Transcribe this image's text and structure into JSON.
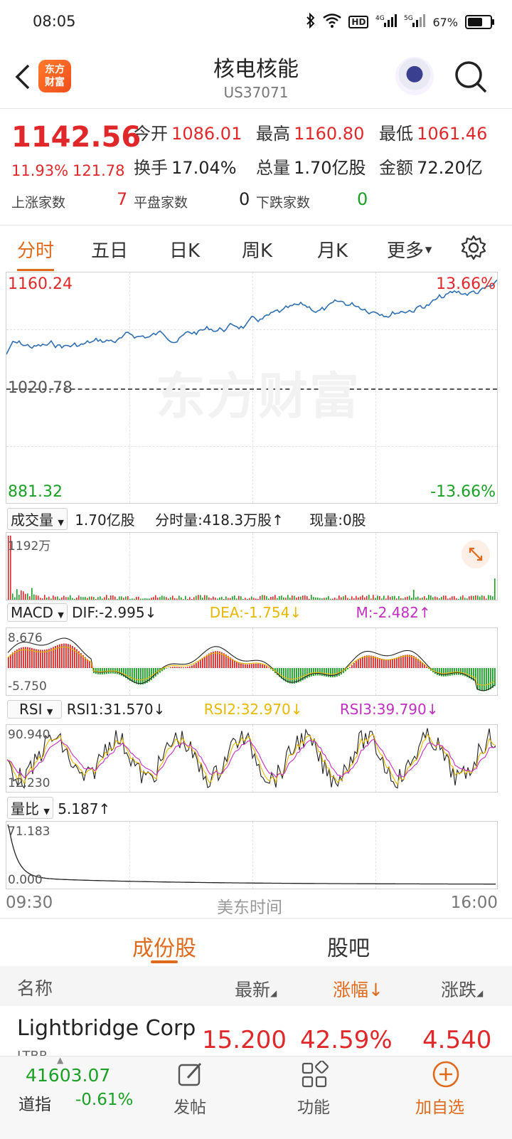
{
  "status": {
    "time": "08:05",
    "battery": "67%",
    "battery_level": 0.67
  },
  "header": {
    "title": "核电核能",
    "code": "US37071",
    "logo_text": "东方财富"
  },
  "quote": {
    "price": "1142.56",
    "change_pct": "11.93%",
    "change": "121.78",
    "stats": [
      {
        "label": "今开",
        "value": "1086.01",
        "color": "red"
      },
      {
        "label": "最高",
        "value": "1160.80",
        "color": "red"
      },
      {
        "label": "最低",
        "value": "1061.46",
        "color": "red"
      },
      {
        "label": "换手",
        "value": "17.04%",
        "color": "dark"
      },
      {
        "label": "总量",
        "value": "1.70亿股",
        "color": "dark"
      },
      {
        "label": "金额",
        "value": "72.20亿",
        "color": "dark"
      }
    ],
    "breadth": [
      {
        "label": "上涨家数",
        "value": "7",
        "color": "red"
      },
      {
        "label": "平盘家数",
        "value": "0",
        "color": "dark"
      },
      {
        "label": "下跌家数",
        "value": "0",
        "color": "green"
      }
    ]
  },
  "tabs": {
    "items": [
      "分时",
      "五日",
      "日K",
      "周K",
      "月K",
      "更多"
    ],
    "active": 0
  },
  "main_chart": {
    "upper": "1160.24",
    "mid": "1020.78",
    "lower": "881.32",
    "upper_pct": "13.66%",
    "lower_pct": "-13.66%",
    "watermark": "东方财富",
    "line_color": "#2f6fb0"
  },
  "volume": {
    "select": "成交量",
    "total": "1.70亿股",
    "minute": "分时量:418.3万股",
    "current": "现量:0股",
    "max": "1192万"
  },
  "macd": {
    "select": "MACD",
    "dif": "DIF:-2.995",
    "dea": "DEA:-1.754",
    "m": "M:-2.482",
    "top": "8.676",
    "bottom": "-5.750"
  },
  "rsi": {
    "select": "RSI",
    "rsi1": "RSI1:31.570",
    "rsi2": "RSI2:32.970",
    "rsi3": "RSI3:39.790",
    "top": "90.940",
    "bottom": "12.230"
  },
  "ratio": {
    "select": "量比",
    "value": "5.187",
    "top": "71.183",
    "bottom": "0.000"
  },
  "time_axis": {
    "start": "09:30",
    "mid": "美东时间",
    "end": "16:00"
  },
  "subtabs": {
    "items": [
      "成份股",
      "股吧"
    ],
    "active": 0
  },
  "table": {
    "headers": [
      "名称",
      "最新",
      "涨幅",
      "涨跌"
    ],
    "rows": [
      {
        "name": "Lightbridge Corp",
        "code": "LTBR",
        "last": "15.200",
        "pct": "42.59%",
        "chg": "4.540"
      }
    ]
  },
  "bottom_nav": {
    "index_value": "41603.07",
    "index_name": "道指",
    "index_pct": "-0.61%",
    "items": [
      "发帖",
      "功能",
      "加自选"
    ]
  }
}
